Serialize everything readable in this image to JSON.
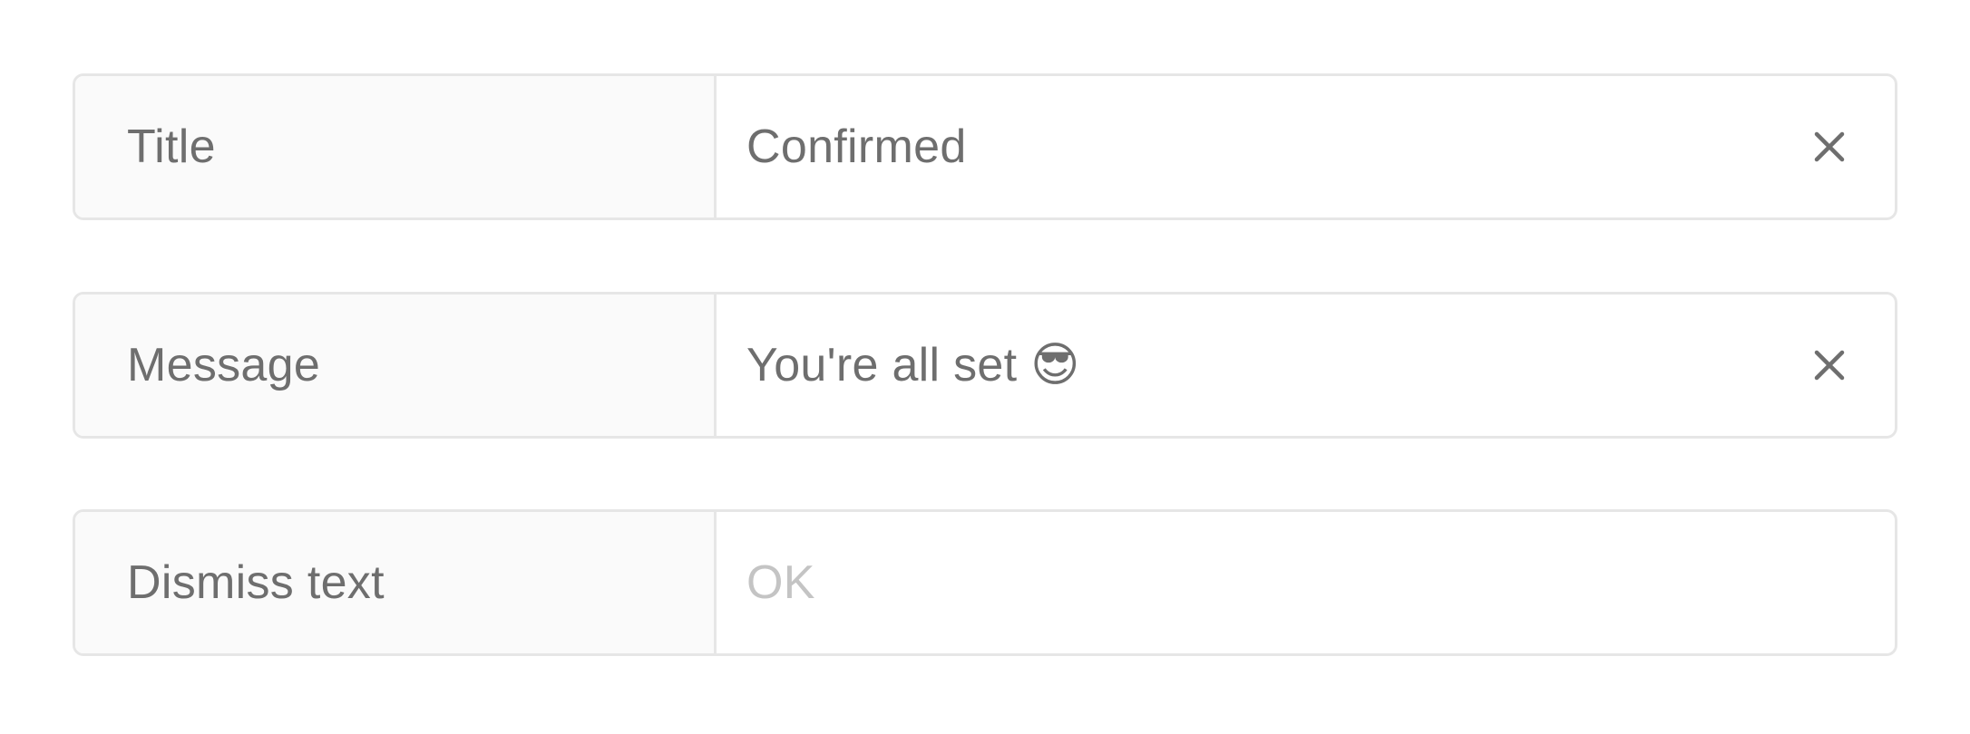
{
  "fields": [
    {
      "label": "Title",
      "value": "Confirmed",
      "placeholder": "",
      "clearable": true
    },
    {
      "label": "Message",
      "value": "You're all set 😎",
      "placeholder": "",
      "clearable": true
    },
    {
      "label": "Dismiss text",
      "value": "",
      "placeholder": "OK",
      "clearable": false
    }
  ],
  "icons": {
    "clear": "close-icon"
  },
  "colors": {
    "label_text": "#6e6e6e",
    "value_text": "#6e6e6e",
    "placeholder_text": "#c4c4c4",
    "border": "#e6e6e6",
    "label_background": "#fafafa"
  }
}
